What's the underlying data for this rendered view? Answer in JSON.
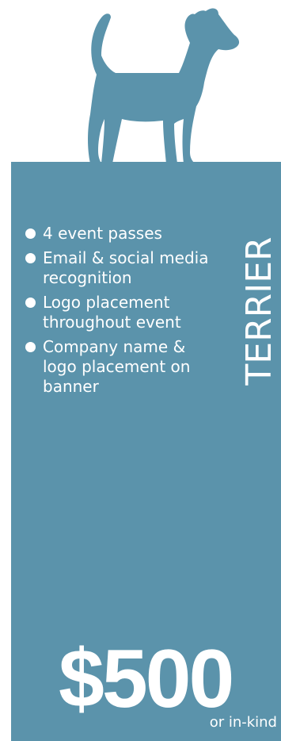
{
  "tier": {
    "name": "TERRIER",
    "icon": "terrier-dog-silhouette-icon",
    "color": "#5b93ab"
  },
  "benefits": [
    "4 event passes",
    "Email & social media recognition",
    "Logo placement throughout event",
    "Company name & logo placement on banner"
  ],
  "price": {
    "amount": "$500",
    "note": "or in-kind"
  }
}
